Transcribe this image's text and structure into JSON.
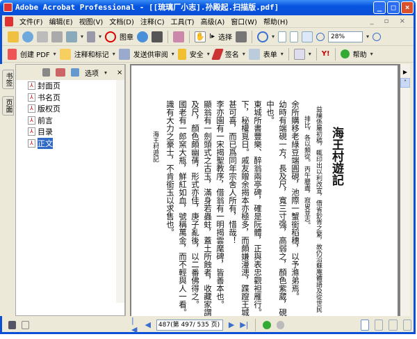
{
  "window": {
    "title": "Adobe Acrobat Professional - [[琉璃厂小志].孙殿起.扫描版.pdf]",
    "controls": [
      "_",
      "□",
      "×"
    ]
  },
  "menu": [
    "文件(F)",
    "编辑(E)",
    "视图(V)",
    "文档(D)",
    "注释(C)",
    "工具(T)",
    "高级(A)",
    "窗口(W)",
    "帮助(H)"
  ],
  "toolbar1": {
    "stamp": "图章",
    "select": "选择",
    "zoom": "28%"
  },
  "toolbar2": {
    "create_pdf": "创建 PDF",
    "comment": "注释和标记",
    "review": "发送供审阅",
    "security": "安全",
    "sign": "签名",
    "forms": "表单",
    "help": "帮助"
  },
  "navtabs": [
    "书签",
    "页面"
  ],
  "bookmarks": {
    "options": "选项",
    "close": "×",
    "items": [
      "封面页",
      "书名页",
      "版权页",
      "前言",
      "目录",
      "正文"
    ],
    "selected": 5
  },
  "page": {
    "title": "海王村遊記",
    "note": [
      "益綸係屬初稿，輒印出以利改宣，借省鈔胥之繁，故仍沿蘇庵體語及從世民",
      "排比，各以類從。丙午臘盡，寂叟並志。"
    ],
    "columns": [
      "余所購移老綠豆端圓硯，池際一蟹銜稻穗，以予滌弟焉。",
      "幼時有端硯一方，長及尺，寬三寸强，高弱之，顏色紫葳，硯池直下",
      "中也。",
      "東城所書豐樂、醉翁兩亭碑，確是阮體，正與表忠觀袒雁行。二亭各",
      "下，秘權覓日。戚友贈余揭本亦極多，而頗嫌漫漶，蹀躞王城，乃恭",
      "甚可喜，而已爲同年宗舍人所有，惜哉！",
      "李亦園有一宋揭聖教序，借翁有一明揭雲麾碑，皆善本也。",
      "顯翁有一劍頭式之古玉，滿身若蟲蛀，蓋土所蝕者，收藏家謂之土古",
      "及尺，顏色頗幽蒨，形式亦佳，庚子亂後，以二番佛得之。",
      "國老有一郎窯大瓶，鮮紅如血，號稱萬金，而不輕與人一看。固知此",
      "識有大力之豪士，不肯銜玉以求售也。"
    ],
    "footer": "海王村遊記"
  },
  "status": {
    "page_field": "487(第 497/ 535 页)"
  }
}
